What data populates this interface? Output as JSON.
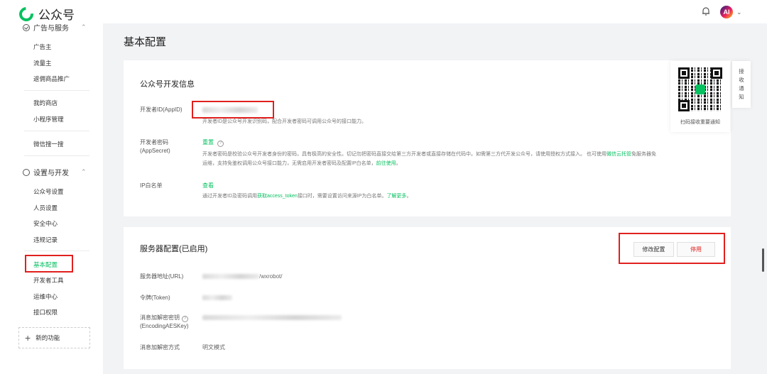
{
  "app": {
    "name": "公众号",
    "avatar_text": "AI"
  },
  "sidebar": {
    "group_ads": {
      "label": "广告与服务"
    },
    "ads_items": [
      "广告主",
      "流量主",
      "返佣商品推广"
    ],
    "shop_items": [
      "我的商店",
      "小程序管理"
    ],
    "misc_items": [
      "微信搜一搜"
    ],
    "group_dev": {
      "label": "设置与开发"
    },
    "dev_items": [
      "公众号设置",
      "人员设置",
      "安全中心",
      "违规记录"
    ],
    "dev_items2": [
      "基本配置",
      "开发者工具",
      "运维中心",
      "接口权限"
    ],
    "new_func": "新的功能"
  },
  "page": {
    "title": "基本配置"
  },
  "dev_info": {
    "title": "公众号开发信息",
    "appid_label": "开发者ID(AppID)",
    "appid_desc": "开发者ID是公众号开发识别码，配合开发者密码可调用公众号的接口能力。",
    "secret_label": "开发者密码(AppSecret)",
    "secret_action": "重置",
    "secret_desc_1": "开发者密码是校验公众号开发者身份的密码，具有极高的安全性。切记勿把密码直接交给第三方开发者或直接存储在代码中。如需第三方代开发公众号，请使用授权方式接入。 也可使用",
    "secret_link_1": "微信云托管",
    "secret_desc_2": "免服务器免",
    "secret_desc_3": "运维，支持免鉴权调用公众号接口能力，无需启用开发者密码及配置IP白名单，",
    "secret_link_2": "前往使用",
    "ip_label": "IP白名单",
    "ip_action": "查看",
    "ip_desc_1": "通过开发者ID及密码调用",
    "ip_link_1": "获取access_token",
    "ip_desc_2": "接口时，需要设置访问来源IP为白名单。",
    "ip_link_2": "了解更多"
  },
  "server": {
    "title": "服务器配置(已启用)",
    "edit_button": "修改配置",
    "enable_button": "停用",
    "url_label": "服务器地址(URL)",
    "url_value": "/wxrobot/",
    "token_label": "令牌(Token)",
    "aes_label_1": "消息加解密密钥",
    "aes_label_2": "(EncodingAESKey)",
    "mode_label": "消息加解密方式",
    "mode_value": "明文模式"
  },
  "qr": {
    "caption": "扫码接收重要通知"
  },
  "notify_tab": [
    "接",
    "收",
    "通",
    "知"
  ]
}
